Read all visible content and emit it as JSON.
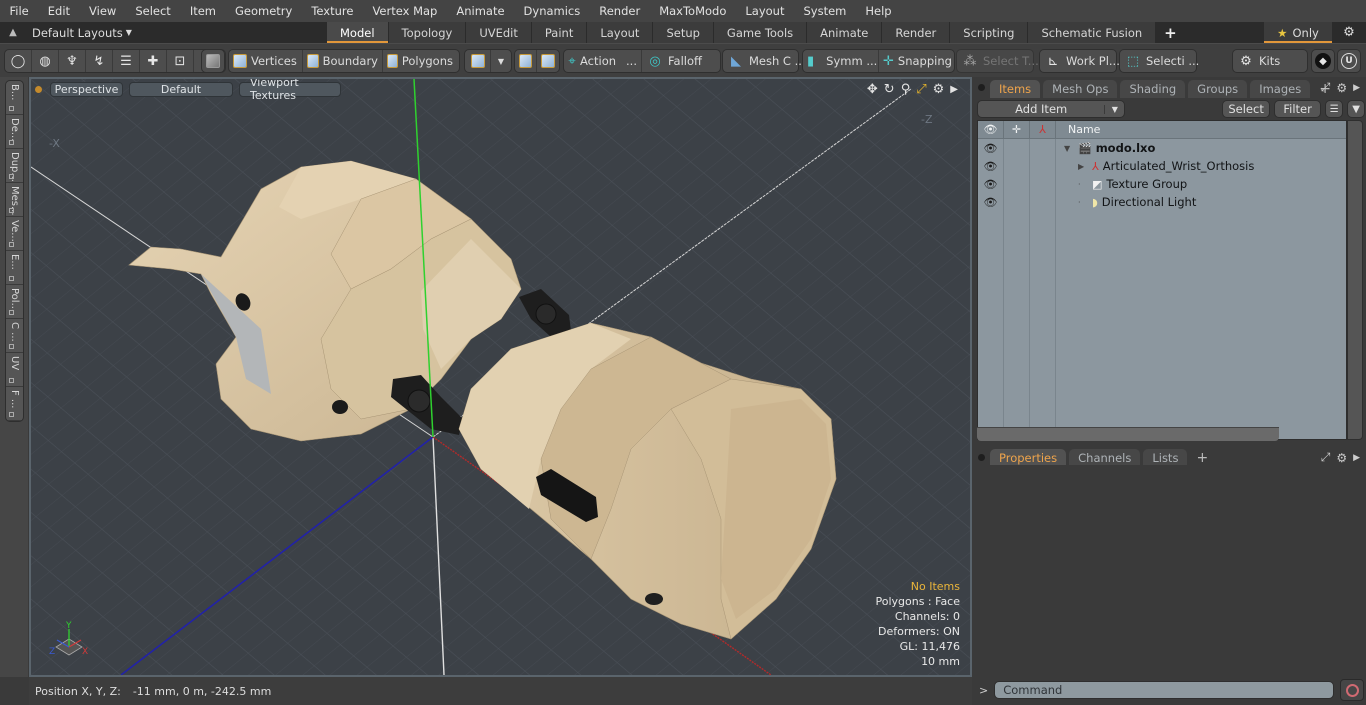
{
  "menu": [
    "File",
    "Edit",
    "View",
    "Select",
    "Item",
    "Geometry",
    "Texture",
    "Vertex Map",
    "Animate",
    "Dynamics",
    "Render",
    "MaxToModo",
    "Layout",
    "System",
    "Help"
  ],
  "layoutbar": {
    "layout_select": "Default Layouts",
    "tabs": [
      "Model",
      "Topology",
      "UVEdit",
      "Paint",
      "Layout",
      "Setup",
      "Game Tools",
      "Animate",
      "Render",
      "Scripting",
      "Schematic Fusion"
    ],
    "active_tab": "Model",
    "only_label": "Only"
  },
  "toolbar": {
    "vertices": "Vertices",
    "boundary": "Boundary",
    "polygons": "Polygons",
    "action": "Action",
    "action_more": "...",
    "falloff": "Falloff",
    "mesh_c": "Mesh C ...",
    "symm": "Symm ...",
    "snapping": "Snapping",
    "select_t": "Select T...",
    "work_pl": "Work Pl...",
    "selecti": "Selecti ...",
    "kits": "Kits"
  },
  "left_tabs": [
    "B...",
    "De...",
    "Dup...",
    "Mes...",
    "Ve...",
    "E...",
    "Pol...",
    "C ...",
    "UV",
    "F ..."
  ],
  "viewport": {
    "view_mode": "Perspective",
    "shading": "Default",
    "textures": "Viewport Textures",
    "info": {
      "selection": "No Items",
      "polygons": "Polygons : Face",
      "channels": "Channels: 0",
      "deformers": "Deformers: ON",
      "gl": "GL: 11,476",
      "grid": "10 mm"
    },
    "axis_labels": {
      "x": "X",
      "y": "Y",
      "z": "Z",
      "neg_z": "-Z",
      "neg_x": "-X"
    }
  },
  "status": {
    "label": "Position X, Y, Z:",
    "value": "-11 mm, 0 m, -242.5 mm"
  },
  "items_panel": {
    "tabs": [
      "Items",
      "Mesh Ops",
      "Shading",
      "Groups",
      "Images"
    ],
    "active_tab": "Items",
    "add_item": "Add Item",
    "select": "Select",
    "filter": "Filter",
    "name_header": "Name",
    "tree": [
      {
        "name": "modo.lxo",
        "level": 0,
        "bold": true,
        "icon": "scene-icon",
        "expanded": true
      },
      {
        "name": "Articulated_Wrist_Orthosis",
        "level": 1,
        "icon": "locator-icon",
        "expandable": true
      },
      {
        "name": "Texture Group",
        "level": 1,
        "icon": "texture-group-icon"
      },
      {
        "name": "Directional Light",
        "level": 1,
        "icon": "light-icon"
      }
    ]
  },
  "props_panel": {
    "tabs": [
      "Properties",
      "Channels",
      "Lists"
    ],
    "active_tab": "Properties"
  },
  "command": {
    "prompt": ">",
    "placeholder": "Command"
  },
  "colors": {
    "accent": "#e2973a",
    "viewport_bg": "#3c4147",
    "mesh": "#d8c6a6",
    "axis_x": "#c0302c",
    "axis_y": "#2fd12f",
    "axis_z": "#2424b8"
  }
}
